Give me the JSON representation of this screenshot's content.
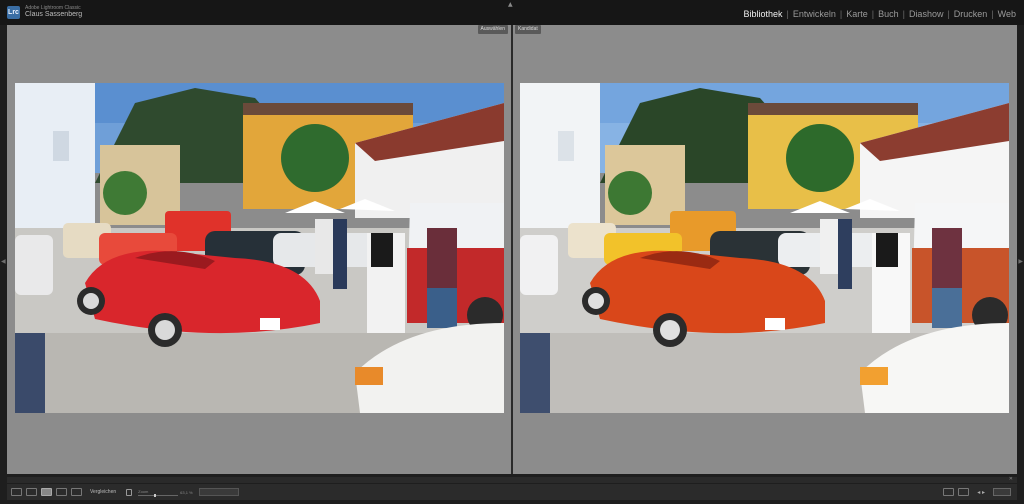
{
  "app": {
    "name": "Adobe Lightroom Classic",
    "user": "Claus Sassenberg",
    "logo": "Lrc"
  },
  "modules": [
    {
      "label": "Bibliothek",
      "active": true
    },
    {
      "label": "Entwickeln",
      "active": false
    },
    {
      "label": "Karte",
      "active": false
    },
    {
      "label": "Buch",
      "active": false
    },
    {
      "label": "Diashow",
      "active": false
    },
    {
      "label": "Drucken",
      "active": false
    },
    {
      "label": "Web",
      "active": false
    }
  ],
  "compare": {
    "select_label": "Auswählen",
    "candidate_label": "Kandidat"
  },
  "toolbar": {
    "compare_label": "Vergleichen",
    "zoom_label": "Zoom",
    "zoom_value": "63,1 %"
  },
  "colors": {
    "accent": "#3a6ea5",
    "panel_bg": "#8c8c8c",
    "chrome_bg": "#1e1e1e",
    "car_left": "#d9262c",
    "car_right": "#d9471a"
  },
  "icons": [
    "lightroom-logo-icon",
    "panel-toggle-arrow-icon",
    "grid-view-icon",
    "loupe-view-icon",
    "compare-view-icon",
    "survey-view-icon",
    "lock-icon",
    "swap-icon",
    "make-select-icon",
    "prev-next-arrows-icon"
  ]
}
